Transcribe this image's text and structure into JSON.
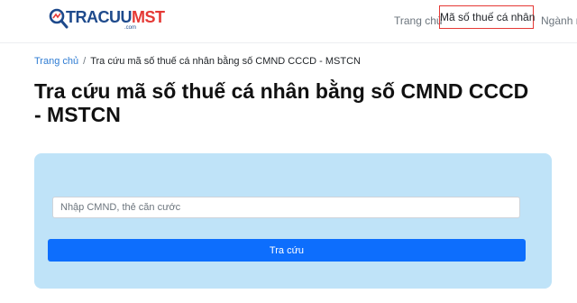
{
  "header": {
    "logo": {
      "brand_main": "TRACUU",
      "brand_accent": "MST",
      "brand_sub": ".com"
    },
    "nav": [
      {
        "label": "Trang chủ"
      },
      {
        "label": "Mã số thuế cá nhân",
        "active": true
      },
      {
        "label": "Ngành n"
      }
    ]
  },
  "breadcrumb": {
    "home": "Trang chủ",
    "separator": "/",
    "current": "Tra cứu mã số thuế cá nhân bằng số CMND CCCD - MSTCN"
  },
  "page_title": "Tra cứu mã số thuế cá nhân bằng số CMND CCCD - MSTCN",
  "search": {
    "input_value": "",
    "placeholder": "Nhập CMND, thẻ căn cước",
    "button_label": "Tra cứu"
  },
  "colors": {
    "brand_blue": "#1e4a8c",
    "brand_red": "#e53935",
    "active_nav_border": "#e53935",
    "panel_bg": "#bfe3f8",
    "button_bg": "#0d6efd",
    "link": "#2f7cd3"
  },
  "icons": {
    "logo": "magnifier-chart-icon"
  }
}
